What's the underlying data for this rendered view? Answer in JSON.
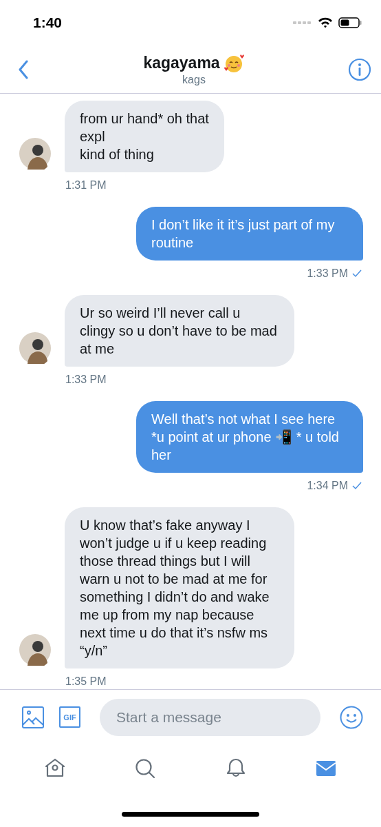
{
  "status_bar": {
    "time": "1:40"
  },
  "header": {
    "title": "kagayama",
    "subtitle": "kags"
  },
  "messages": [
    {
      "kind": "received",
      "text": "from ur hand* oh that\nexpl\nkind of thing",
      "time": "1:31 PM"
    },
    {
      "kind": "sent",
      "text": "I don’t like it it’s just part of my routine",
      "time": "1:33 PM",
      "read": true
    },
    {
      "kind": "received",
      "text": "Ur so weird I’ll never call u clingy so u don’t have to be mad at me",
      "time": "1:33 PM"
    },
    {
      "kind": "sent",
      "text": "Well that’s not what I see here *u point at ur phone 📲 * u told her",
      "time": "1:34 PM",
      "read": true
    },
    {
      "kind": "received",
      "text": "U know that’s fake anyway I won’t judge u if u keep reading those thread things but I will warn u not to be mad at me for something I didn’t do and wake me up from my nap because next time u do that it’s nsfw ms “y/n”",
      "time": "1:35 PM"
    }
  ],
  "composer": {
    "placeholder": "Start a message",
    "gif_label": "GIF"
  },
  "tab_bar": [
    {
      "selected": false
    },
    {
      "selected": false
    },
    {
      "selected": false
    },
    {
      "selected": true
    }
  ]
}
